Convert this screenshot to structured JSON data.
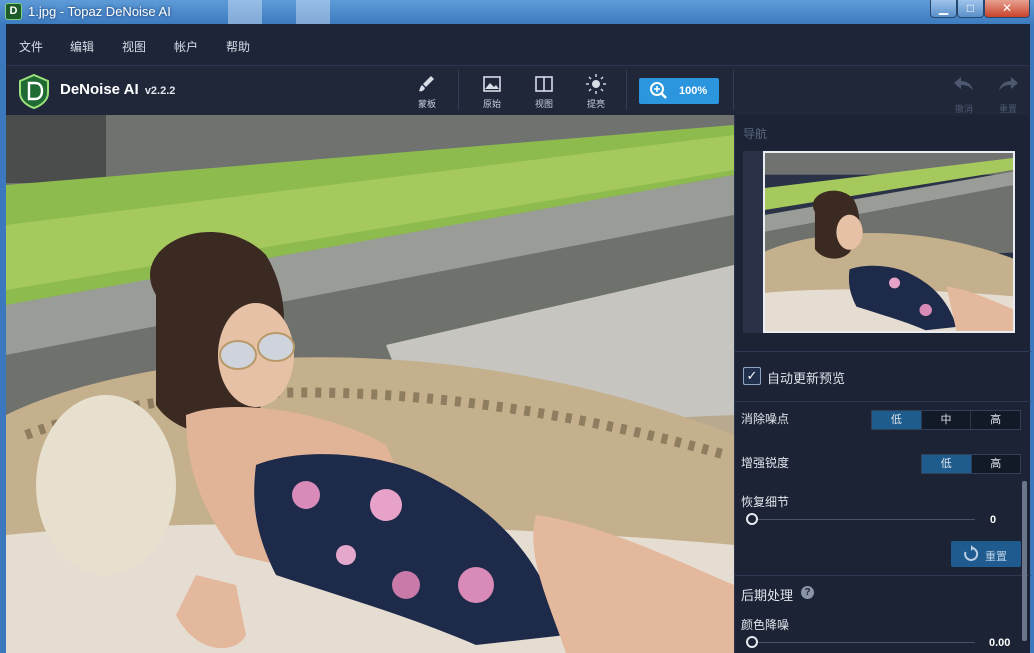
{
  "window": {
    "title": "1.jpg - Topaz DeNoise AI",
    "app_icon_letter": "D",
    "controls": {
      "minimize": "▁",
      "maximize": "□",
      "close": "✕"
    }
  },
  "menu": [
    "文件",
    "编辑",
    "视图",
    "帐户",
    "帮助"
  ],
  "toolbar": {
    "app_name": "DeNoise AI",
    "version": "v2.2.2",
    "tools": [
      {
        "label": "蒙板",
        "icon": "brush-icon"
      },
      {
        "label": "原始",
        "icon": "image-icon"
      },
      {
        "label": "视图",
        "icon": "split-view-icon"
      },
      {
        "label": "提亮",
        "icon": "sun-icon"
      }
    ],
    "zoom_label": "100%",
    "undo_label": "撤消",
    "redo_label": "重置"
  },
  "panel": {
    "navigator_title": "导航",
    "auto_preview_label": "自动更新预览",
    "auto_preview_checked": true,
    "remove_noise": {
      "label": "消除噪点",
      "options": [
        "低",
        "中",
        "高"
      ],
      "selected": "低"
    },
    "enhance_sharpness": {
      "label": "增强锐度",
      "options": [
        "低",
        "高"
      ],
      "selected": "低"
    },
    "recover_detail": {
      "label": "恢复细节",
      "value": "0"
    },
    "reset_label": "重置",
    "post_processing_label": "后期处理",
    "color_denoise": {
      "label": "颜色降噪",
      "value": "0.00"
    }
  },
  "colors": {
    "accent": "#2b96de",
    "selected": "#1e5c8e",
    "panel_bg": "#1b2335"
  }
}
